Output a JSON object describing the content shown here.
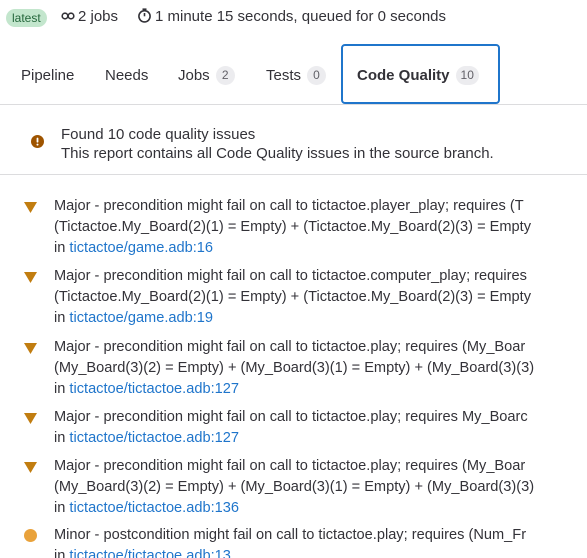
{
  "header": {
    "badge": "latest",
    "jobs": "2 jobs",
    "duration": "1 minute 15 seconds, queued for 0 seconds"
  },
  "tabs": [
    {
      "label": "Pipeline"
    },
    {
      "label": "Needs"
    },
    {
      "label": "Jobs",
      "count": "2"
    },
    {
      "label": "Tests",
      "count": "0"
    },
    {
      "label": "Code Quality",
      "count": "10"
    }
  ],
  "summary": {
    "title": "Found 10 code quality issues",
    "subtitle": "This report contains all Code Quality issues in the source branch."
  },
  "issues": [
    {
      "severity": "major",
      "lines": [
        "Major - precondition might fail on call to tictactoe.player_play; requires (T",
        "(Tictactoe.My_Board(2)(1) = Empty) + (Tictactoe.My_Board(2)(3) = Empty"
      ],
      "in": "in ",
      "link": "tictactoe/game.adb:16"
    },
    {
      "severity": "major",
      "lines": [
        "Major - precondition might fail on call to tictactoe.computer_play; requires",
        "(Tictactoe.My_Board(2)(1) = Empty) + (Tictactoe.My_Board(2)(3) = Empty"
      ],
      "in": "in ",
      "link": "tictactoe/game.adb:19"
    },
    {
      "severity": "major",
      "lines": [
        "Major - precondition might fail on call to tictactoe.play; requires (My_Boar",
        "(My_Board(3)(2) = Empty) + (My_Board(3)(1) = Empty) + (My_Board(3)(3)"
      ],
      "in": "in ",
      "link": "tictactoe/tictactoe.adb:127"
    },
    {
      "severity": "major",
      "lines": [
        "Major - precondition might fail on call to tictactoe.play; requires My_Boarc"
      ],
      "in": "in ",
      "link": "tictactoe/tictactoe.adb:127"
    },
    {
      "severity": "major",
      "lines": [
        "Major - precondition might fail on call to tictactoe.play; requires (My_Boar",
        "(My_Board(3)(2) = Empty) + (My_Board(3)(1) = Empty) + (My_Board(3)(3)"
      ],
      "in": "in ",
      "link": "tictactoe/tictactoe.adb:136"
    },
    {
      "severity": "minor",
      "lines": [
        "Minor - postcondition might fail on call to tictactoe.play; requires (Num_Fr"
      ],
      "in": "in ",
      "link": "tictactoe/tictactoe.adb:13"
    }
  ],
  "colors": {
    "link": "#1f75cb",
    "major": "#c17d10",
    "minor": "#e9a23b",
    "accent": "#1f75cb"
  }
}
